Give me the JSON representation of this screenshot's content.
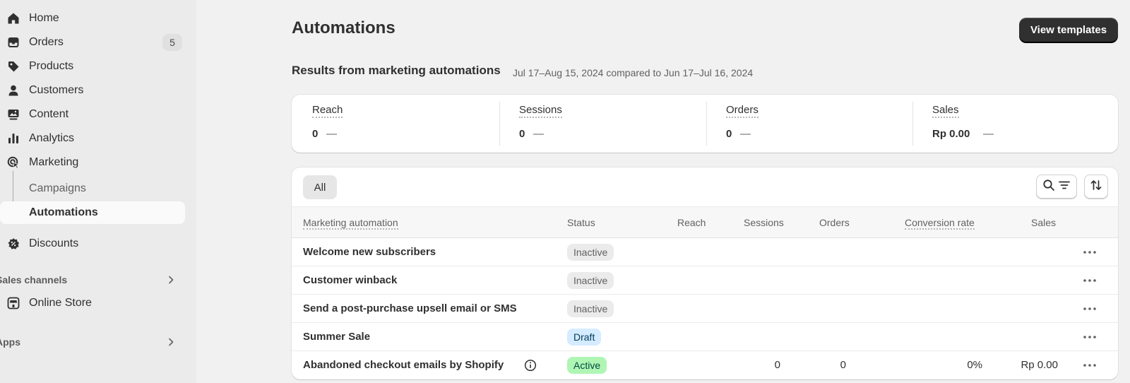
{
  "sidebar": {
    "items": [
      {
        "label": "Home",
        "icon": "home-icon"
      },
      {
        "label": "Orders",
        "icon": "inbox-icon",
        "badge": "5"
      },
      {
        "label": "Products",
        "icon": "tag-icon"
      },
      {
        "label": "Customers",
        "icon": "person-icon"
      },
      {
        "label": "Content",
        "icon": "image-icon"
      },
      {
        "label": "Analytics",
        "icon": "bar-chart-icon"
      },
      {
        "label": "Marketing",
        "icon": "target-icon"
      },
      {
        "label": "Campaigns"
      },
      {
        "label": "Automations"
      },
      {
        "label": "Discounts",
        "icon": "discount-icon"
      }
    ],
    "sales_channels_label": "Sales channels",
    "online_store_label": "Online Store",
    "apps_label": "Apps"
  },
  "header": {
    "title": "Automations",
    "view_templates_label": "View templates"
  },
  "results": {
    "title": "Results from marketing automations",
    "range": "Jul 17–Aug 15, 2024 compared to Jun 17–Jul 16, 2024"
  },
  "metrics": [
    {
      "label": "Reach",
      "value": "0",
      "change": "—"
    },
    {
      "label": "Sessions",
      "value": "0",
      "change": "—"
    },
    {
      "label": "Orders",
      "value": "0",
      "change": "—"
    },
    {
      "label": "Sales",
      "value": "Rp 0.00",
      "change": "—"
    }
  ],
  "table": {
    "tab_all": "All",
    "columns": {
      "automation": "Marketing automation",
      "status": "Status",
      "reach": "Reach",
      "sessions": "Sessions",
      "orders": "Orders",
      "conversion": "Conversion rate",
      "sales": "Sales"
    },
    "rows": [
      {
        "name": "Welcome new subscribers",
        "status": "Inactive"
      },
      {
        "name": "Customer winback",
        "status": "Inactive"
      },
      {
        "name": "Send a post-purchase upsell email or SMS",
        "status": "Inactive"
      },
      {
        "name": "Summer Sale",
        "status": "Draft"
      },
      {
        "name": "Abandoned checkout emails by Shopify",
        "status": "Active",
        "sessions": "0",
        "orders": "0",
        "conversion": "0%",
        "sales": "Rp 0.00"
      }
    ]
  },
  "colors": {
    "primary_button": "#303030",
    "status_inactive": "#ebebeb",
    "status_draft": "#d5ebff",
    "status_active": "#aff5b4"
  }
}
